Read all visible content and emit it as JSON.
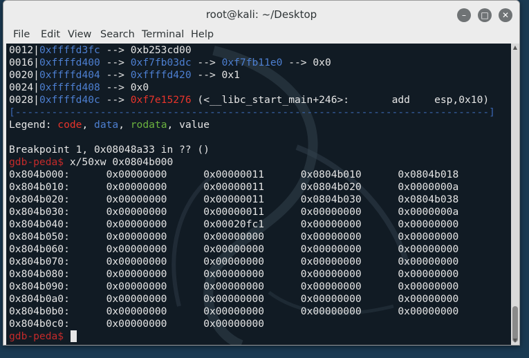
{
  "window": {
    "title": "root@kali: ~/Desktop",
    "minimize_glyph": "–",
    "maximize_glyph": "□",
    "close_glyph": "✕"
  },
  "menu": [
    "File",
    "Edit",
    "View",
    "Search",
    "Terminal",
    "Help"
  ],
  "stack_lines": [
    {
      "off": "0012|",
      "addr": "0xffffd3fc",
      "rest": [
        {
          "t": " --> ",
          "c": ""
        },
        {
          "t": "0xb253cd00",
          "c": ""
        }
      ]
    },
    {
      "off": "0016|",
      "addr": "0xffffd400",
      "rest": [
        {
          "t": " --> ",
          "c": ""
        },
        {
          "t": "0xf7fb03dc",
          "c": "data"
        },
        {
          "t": " --> ",
          "c": ""
        },
        {
          "t": "0xf7fb11e0",
          "c": "data"
        },
        {
          "t": " --> 0x0",
          "c": ""
        }
      ]
    },
    {
      "off": "0020|",
      "addr": "0xffffd404",
      "rest": [
        {
          "t": " --> ",
          "c": ""
        },
        {
          "t": "0xffffd420",
          "c": "data"
        },
        {
          "t": " --> 0x1",
          "c": ""
        }
      ]
    },
    {
      "off": "0024|",
      "addr": "0xffffd408",
      "rest": [
        {
          "t": " --> 0x0",
          "c": ""
        }
      ]
    },
    {
      "off": "0028|",
      "addr": "0xffffd40c",
      "rest": [
        {
          "t": " --> ",
          "c": ""
        },
        {
          "t": "0xf7e15276",
          "c": "code"
        },
        {
          "t": " (<__libc_start_main+246>:       add    esp,0x10)",
          "c": ""
        }
      ]
    }
  ],
  "separator": "[------------------------------------------------------------------------------]",
  "legend": {
    "prefix": "Legend: ",
    "code": "code",
    "data": "data",
    "rodata": "rodata",
    "value": "value",
    "sep": ", "
  },
  "breakpoint": "Breakpoint 1, 0x08048a33 in ?? ()",
  "prompt": "gdb-peda$",
  "command": " x/50xw 0x0804b000",
  "memory_rows": [
    {
      "addr": "0x804b000:",
      "words": [
        "0x00000000",
        "0x00000011",
        "0x0804b010",
        "0x0804b018"
      ]
    },
    {
      "addr": "0x804b010:",
      "words": [
        "0x00000000",
        "0x00000011",
        "0x0804b020",
        "0x0000000a"
      ]
    },
    {
      "addr": "0x804b020:",
      "words": [
        "0x00000000",
        "0x00000011",
        "0x0804b030",
        "0x0804b038"
      ]
    },
    {
      "addr": "0x804b030:",
      "words": [
        "0x00000000",
        "0x00000011",
        "0x00000000",
        "0x0000000a"
      ]
    },
    {
      "addr": "0x804b040:",
      "words": [
        "0x00000000",
        "0x00020fc1",
        "0x00000000",
        "0x00000000"
      ]
    },
    {
      "addr": "0x804b050:",
      "words": [
        "0x00000000",
        "0x00000000",
        "0x00000000",
        "0x00000000"
      ]
    },
    {
      "addr": "0x804b060:",
      "words": [
        "0x00000000",
        "0x00000000",
        "0x00000000",
        "0x00000000"
      ]
    },
    {
      "addr": "0x804b070:",
      "words": [
        "0x00000000",
        "0x00000000",
        "0x00000000",
        "0x00000000"
      ]
    },
    {
      "addr": "0x804b080:",
      "words": [
        "0x00000000",
        "0x00000000",
        "0x00000000",
        "0x00000000"
      ]
    },
    {
      "addr": "0x804b090:",
      "words": [
        "0x00000000",
        "0x00000000",
        "0x00000000",
        "0x00000000"
      ]
    },
    {
      "addr": "0x804b0a0:",
      "words": [
        "0x00000000",
        "0x00000000",
        "0x00000000",
        "0x00000000"
      ]
    },
    {
      "addr": "0x804b0b0:",
      "words": [
        "0x00000000",
        "0x00000000",
        "0x00000000",
        "0x00000000"
      ]
    },
    {
      "addr": "0x804b0c0:",
      "words": [
        "0x00000000",
        "0x00000000"
      ]
    }
  ],
  "colors": {
    "terminal_bg": "#111b24",
    "text": "#e6e6e6",
    "address_blue": "#4d7fd1",
    "code_red": "#e8342b",
    "rodata_green": "#6cb33f",
    "prompt_red": "#c42a2a"
  }
}
